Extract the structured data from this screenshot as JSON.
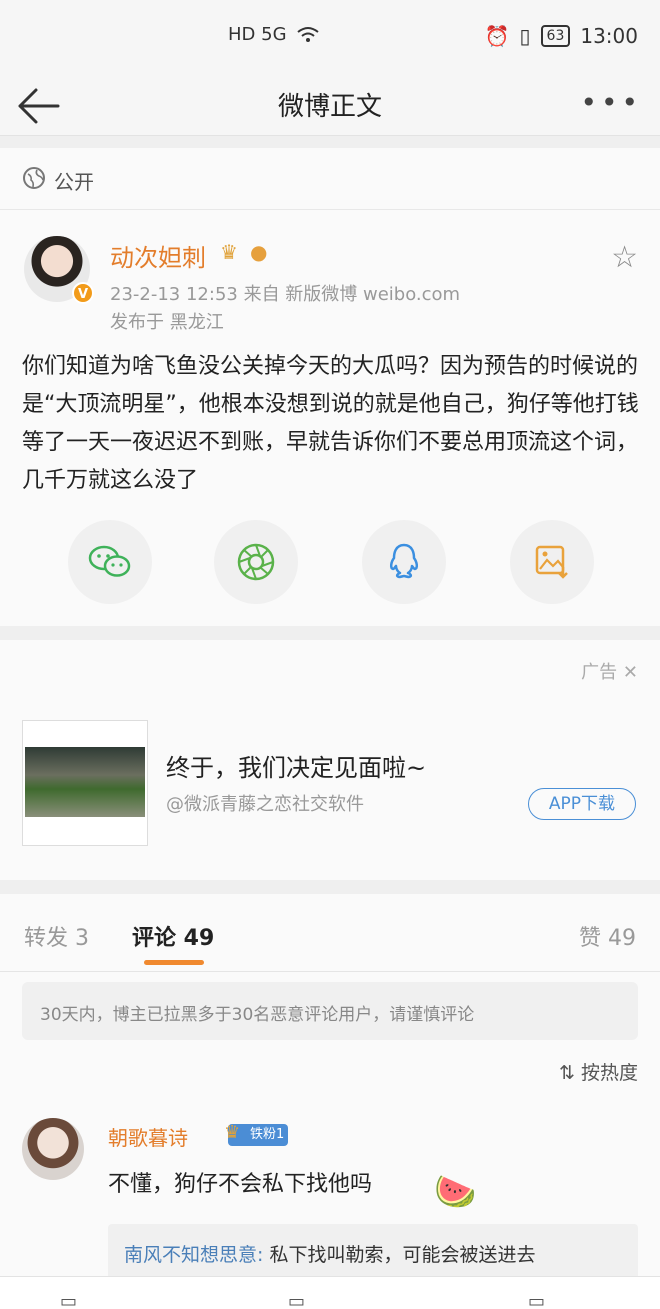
{
  "status_bar": {
    "signal": "HD 5G",
    "battery": "63",
    "time": "13:00"
  },
  "nav": {
    "title": "微博正文",
    "more": "•••"
  },
  "visibility": {
    "label": "公开"
  },
  "post": {
    "author": "动次妲刺",
    "verified_badge": "V",
    "meta": "23-2-13 12:53  来自 新版微博 weibo.com",
    "location": "发布于 黑龙江",
    "text": "你们知道为啥飞鱼没公关掉今天的大瓜吗？因为预告的时候说的是“大顶流明星”，他根本没想到说的就是他自己，狗仔等他打钱等了一天一夜迟迟不到账，早就告诉你们不要总用顶流这个词，几千万就这么没了",
    "share_icons": [
      "wechat-icon",
      "moments-icon",
      "qq-icon",
      "save-image-icon"
    ]
  },
  "ad": {
    "label": "广告",
    "title": "终于，我们决定见面啦~",
    "source": "@微派青藤之恋社交软件",
    "button": "APP下载"
  },
  "tabs": {
    "repost": "转发 3",
    "comment": "评论 49",
    "like": "赞 49"
  },
  "comments": {
    "notice": "30天内，博主已拉黑多于30名恶意评论用户，请谨慎评论",
    "sort": "按热度",
    "items": [
      {
        "name": "朝歌暮诗",
        "badge": "铁粉1",
        "text": "不懂，狗仔不会私下找他吗",
        "emoji": "🍉",
        "reply_name": "南风不知想思意:",
        "reply_text": " 私下找叫勒索，可能会被送进去"
      }
    ]
  },
  "colors": {
    "accent": "#e37d2b",
    "link": "#4a7fb8",
    "tab_underline": "#f0892f"
  }
}
